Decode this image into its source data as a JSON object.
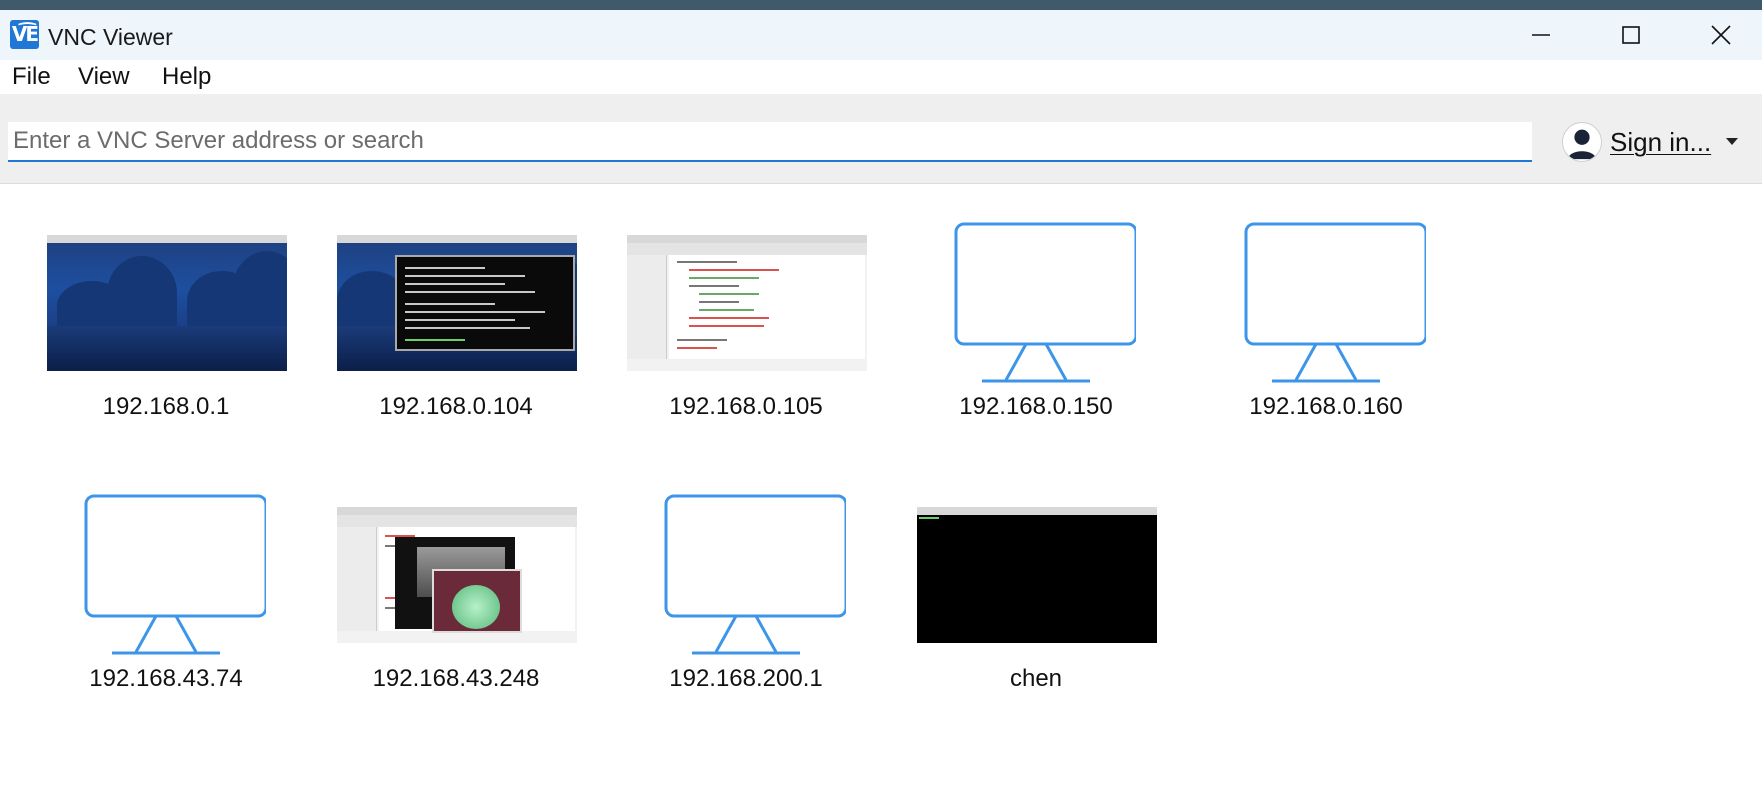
{
  "window": {
    "title": "VNC Viewer",
    "logo_text": "V͡E"
  },
  "menu": [
    "File",
    "View",
    "Help"
  ],
  "search": {
    "placeholder": "Enter a VNC Server address or search",
    "value": ""
  },
  "account": {
    "signin_label": "Sign in..."
  },
  "connections": [
    {
      "label": "192.168.0.1",
      "thumbnail": "desktop-landscape"
    },
    {
      "label": "192.168.0.104",
      "thumbnail": "desktop-terminal"
    },
    {
      "label": "192.168.0.105",
      "thumbnail": "desktop-ide"
    },
    {
      "label": "192.168.0.150",
      "thumbnail": "monitor-icon"
    },
    {
      "label": "192.168.0.160",
      "thumbnail": "monitor-icon"
    },
    {
      "label": "192.168.43.74",
      "thumbnail": "monitor-icon"
    },
    {
      "label": "192.168.43.248",
      "thumbnail": "desktop-ide-image"
    },
    {
      "label": "192.168.200.1",
      "thumbnail": "monitor-icon"
    },
    {
      "label": "chen",
      "thumbnail": "desktop-black"
    }
  ],
  "colors": {
    "accent": "#1f77d6",
    "monitor_icon": "#3d95ea"
  }
}
